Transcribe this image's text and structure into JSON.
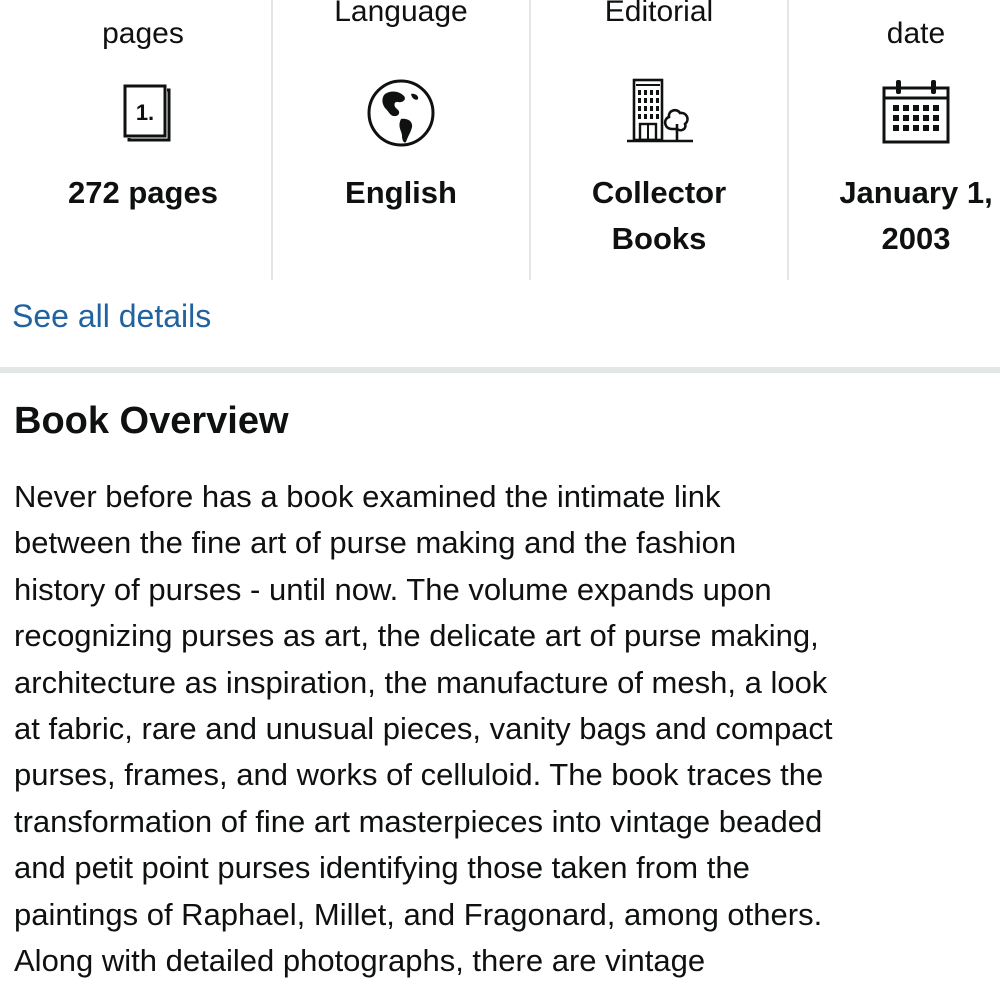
{
  "details": {
    "items": [
      {
        "label": "pages",
        "value_lines": [
          "272 pages"
        ],
        "icon": "page-count-icon"
      },
      {
        "label": "Language",
        "value_lines": [
          "English"
        ],
        "icon": "globe-icon"
      },
      {
        "label": "Editorial",
        "value_lines": [
          "Collector",
          "Books"
        ],
        "icon": "publisher-building-icon"
      },
      {
        "label": "date",
        "value_lines": [
          "January 1,",
          "2003"
        ],
        "icon": "calendar-icon"
      }
    ],
    "page_icon_text": "1.",
    "see_all_label": "See all details"
  },
  "overview": {
    "title": "Book Overview",
    "lines": [
      "Never before has a book examined the intimate link",
      "between the fine art of purse making and the fashion",
      "history of purses - until now. The volume expands upon",
      "recognizing purses as art, the delicate art of purse making,",
      "architecture as inspiration, the manufacture of mesh, a look",
      "at fabric, rare and unusual pieces, vanity bags and compact",
      "purses, frames, and works of celluloid. The book traces the",
      "transformation of fine art masterpieces into vintage beaded",
      "and petit point purses identifying those taken from the",
      "paintings of Raphael, Millet, and Fragonard, among others.",
      "Along with detailed photographs, there are vintage"
    ]
  },
  "colors": {
    "link": "#2162a1",
    "text": "#0f1111",
    "divider": "#e3e6e6"
  }
}
